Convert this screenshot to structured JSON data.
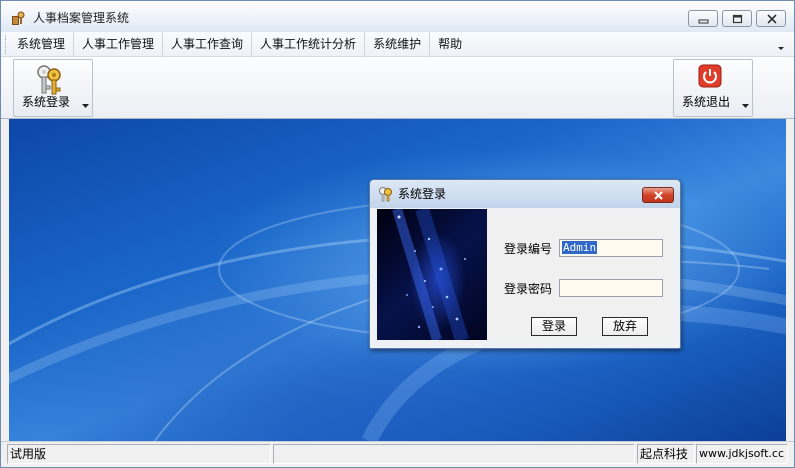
{
  "window": {
    "title": "人事档案管理系统"
  },
  "menu": {
    "items": [
      {
        "label": "系统管理"
      },
      {
        "label": "人事工作管理"
      },
      {
        "label": "人事工作查询"
      },
      {
        "label": "人事工作统计分析"
      },
      {
        "label": "系统维护"
      },
      {
        "label": "帮助"
      }
    ]
  },
  "toolbar": {
    "login_label": "系统登录",
    "exit_label": "系统退出"
  },
  "dialog": {
    "title": "系统登录",
    "user_label": "登录编号",
    "user_value": "Admin",
    "password_label": "登录密码",
    "password_value": "",
    "login_button": "登录",
    "cancel_button": "放弃"
  },
  "status": {
    "edition": "试用版",
    "company": "起点科技",
    "website": "www.jdkjsoft.cc"
  },
  "colors": {
    "accent": "#1a67c9",
    "close_red": "#d2452b",
    "exit_icon": "#e03c2a"
  }
}
